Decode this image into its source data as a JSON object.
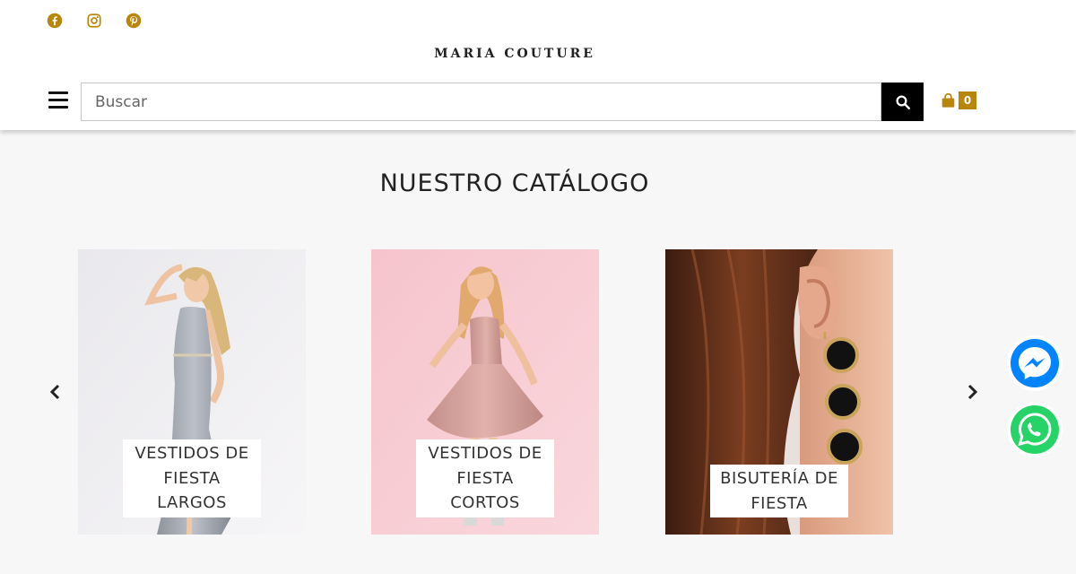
{
  "header": {
    "brand": "MARIA COUTURE",
    "social": [
      {
        "icon": "facebook-icon"
      },
      {
        "icon": "instagram-icon"
      },
      {
        "icon": "pinterest-icon"
      }
    ],
    "search": {
      "placeholder": "Buscar",
      "value": ""
    },
    "cart": {
      "count": "0"
    }
  },
  "catalog": {
    "title": "NUESTRO CATÁLOGO",
    "items": [
      {
        "label": "VESTIDOS DE FIESTA LARGOS"
      },
      {
        "label": "VESTIDOS DE FIESTA CORTOS"
      },
      {
        "label": "BISUTERÍA DE FIESTA"
      }
    ]
  },
  "colors": {
    "accent": "#b8860b",
    "messenger": "#0084ff",
    "whatsapp": "#25d366"
  }
}
